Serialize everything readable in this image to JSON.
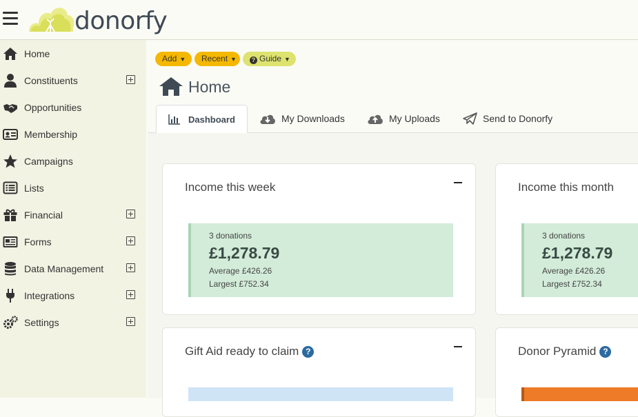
{
  "app": {
    "brand": "donorfy"
  },
  "sidebar": {
    "items": [
      {
        "label": "Home",
        "icon": "home-icon",
        "expandable": false
      },
      {
        "label": "Constituents",
        "icon": "user-icon",
        "expandable": true
      },
      {
        "label": "Opportunities",
        "icon": "handshake-icon",
        "expandable": false
      },
      {
        "label": "Membership",
        "icon": "id-card-icon",
        "expandable": false
      },
      {
        "label": "Campaigns",
        "icon": "star-icon",
        "expandable": false
      },
      {
        "label": "Lists",
        "icon": "list-icon",
        "expandable": false
      },
      {
        "label": "Financial",
        "icon": "gift-icon",
        "expandable": true
      },
      {
        "label": "Forms",
        "icon": "newspaper-icon",
        "expandable": true
      },
      {
        "label": "Data Management",
        "icon": "database-icon",
        "expandable": true
      },
      {
        "label": "Integrations",
        "icon": "plug-icon",
        "expandable": true
      },
      {
        "label": "Settings",
        "icon": "gears-icon",
        "expandable": true
      }
    ]
  },
  "toolbar": {
    "add_label": "Add",
    "recent_label": "Recent",
    "guide_label": "Guide"
  },
  "page": {
    "title": "Home"
  },
  "tabs": [
    {
      "label": "Dashboard",
      "icon": "bar-chart-icon",
      "active": true
    },
    {
      "label": "My Downloads",
      "icon": "cloud-download-icon",
      "active": false
    },
    {
      "label": "My Uploads",
      "icon": "cloud-upload-icon",
      "active": false
    },
    {
      "label": "Send to Donorfy",
      "icon": "paper-plane-icon",
      "active": false
    }
  ],
  "cards": {
    "week": {
      "title": "Income this week",
      "count": "3 donations",
      "amount": "£1,278.79",
      "average": "Average £426.26",
      "largest": "Largest £752.34"
    },
    "month": {
      "title": "Income this month",
      "count": "3 donations",
      "amount": "£1,278.79",
      "average": "Average £426.26",
      "largest": "Largest £752.34"
    },
    "gift_aid": {
      "title": "Gift Aid ready to claim"
    },
    "pyramid": {
      "title": "Donor Pyramid"
    }
  },
  "colors": {
    "accent_yellow": "#f5b800",
    "guide_green": "#dde36e",
    "stat_green": "#d3ecd9",
    "info_blue": "#2c6aa0",
    "pyramid_orange": "#ed7b27"
  }
}
